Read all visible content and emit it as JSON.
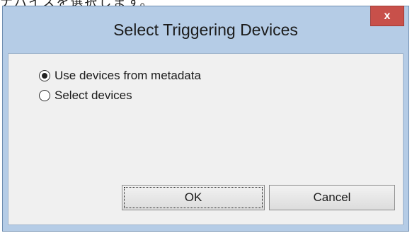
{
  "background": {
    "top_text": "ナバイスを選択します。"
  },
  "dialog": {
    "title": "Select Triggering Devices",
    "close_label": "x",
    "options": [
      {
        "label": "Use devices from metadata",
        "selected": true
      },
      {
        "label": "Select devices",
        "selected": false
      }
    ],
    "buttons": {
      "ok_label": "OK",
      "cancel_label": "Cancel"
    }
  },
  "colors": {
    "frame": "#b5cce6",
    "close_button": "#c8504a",
    "client_area": "#f0f0f0"
  }
}
